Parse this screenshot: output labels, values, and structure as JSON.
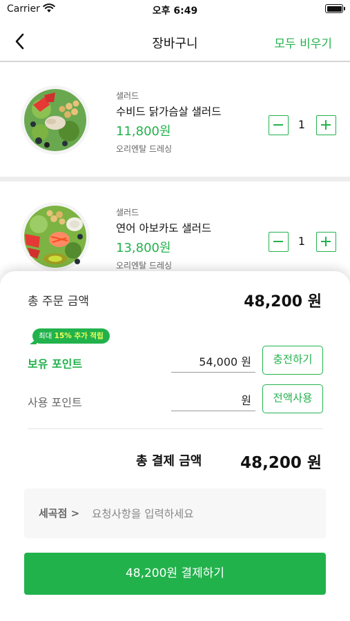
{
  "status_bar": {
    "carrier": "Carrier",
    "time": "오후 6:49"
  },
  "nav": {
    "title": "장바구니",
    "clear_all": "모두 비우기"
  },
  "cart": {
    "items": [
      {
        "category": "샐러드",
        "name": "수비드 닭가슴살 샐러드",
        "price": "11,800원",
        "option": "오리엔탈 드레싱",
        "quantity": "1"
      },
      {
        "category": "샐러드",
        "name": "연어 아보카도 샐러드",
        "price": "13,800원",
        "option": "오리엔탈 드레싱",
        "quantity": "1"
      }
    ]
  },
  "summary": {
    "total_order_label": "총 주문 금액",
    "total_order_value": "48,200 원",
    "point_bubble": {
      "prefix": "최대 ",
      "highlight": "15% 추가 적립",
      "suffix": ""
    },
    "owned_points_label": "보유 포인트",
    "owned_points_value": "54,000 원",
    "charge_button": "충전하기",
    "use_points_label": "사용 포인트",
    "use_points_unit": "원",
    "use_all_button": "전액사용",
    "final_label": "총 결제 금액",
    "final_value": "48,200 원",
    "store_link": "세곡점 >",
    "request_placeholder": "요청사항을 입력하세요",
    "pay_button": "48,200원 결제하기"
  },
  "colors": {
    "accent": "#22b24c",
    "highlight": "#f3ff5a"
  }
}
